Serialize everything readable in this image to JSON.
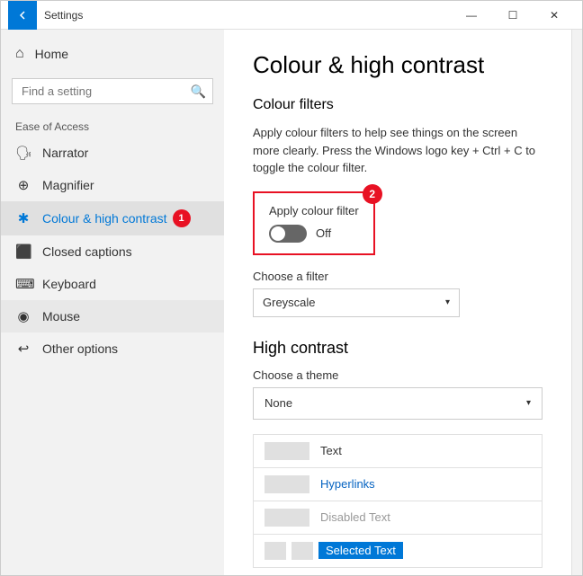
{
  "titlebar": {
    "back_label": "←",
    "title": "Settings",
    "minimize": "—",
    "maximize": "☐",
    "close": "✕"
  },
  "sidebar": {
    "home_label": "Home",
    "search_placeholder": "Find a setting",
    "section_label": "Ease of Access",
    "items": [
      {
        "label": "Narrator",
        "icon": "🗣"
      },
      {
        "label": "Magnifier",
        "icon": "🔍"
      },
      {
        "label": "Colour & high contrast",
        "icon": "✱",
        "active": true
      },
      {
        "label": "Closed captions",
        "icon": "⬛"
      },
      {
        "label": "Keyboard",
        "icon": "⌨"
      },
      {
        "label": "Mouse",
        "icon": "🖱"
      },
      {
        "label": "Other options",
        "icon": "⚙"
      }
    ]
  },
  "content": {
    "page_title": "Colour & high contrast",
    "colour_filters": {
      "section_title": "Colour filters",
      "description": "Apply colour filters to help see things on the screen more clearly. Press the Windows logo key + Ctrl + C to toggle the colour filter.",
      "apply_label": "Apply colour filter",
      "toggle_state": "Off",
      "choose_filter_label": "Choose a filter",
      "filter_value": "Greyscale"
    },
    "high_contrast": {
      "section_title": "High contrast",
      "choose_theme_label": "Choose a theme",
      "theme_value": "None",
      "preview_rows": [
        {
          "swatch_color": "#e0e0e0",
          "text": "Text",
          "text_type": "normal"
        },
        {
          "swatch_color": "#e0e0e0",
          "text": "Hyperlinks",
          "text_type": "link"
        },
        {
          "swatch_color": "#e0e0e0",
          "text": "Disabled Text",
          "text_type": "disabled"
        },
        {
          "swatch_color": "#e0e0e0",
          "text": "Selected Text",
          "text_type": "selected"
        }
      ]
    }
  },
  "badges": {
    "step1": "1",
    "step2": "2"
  }
}
